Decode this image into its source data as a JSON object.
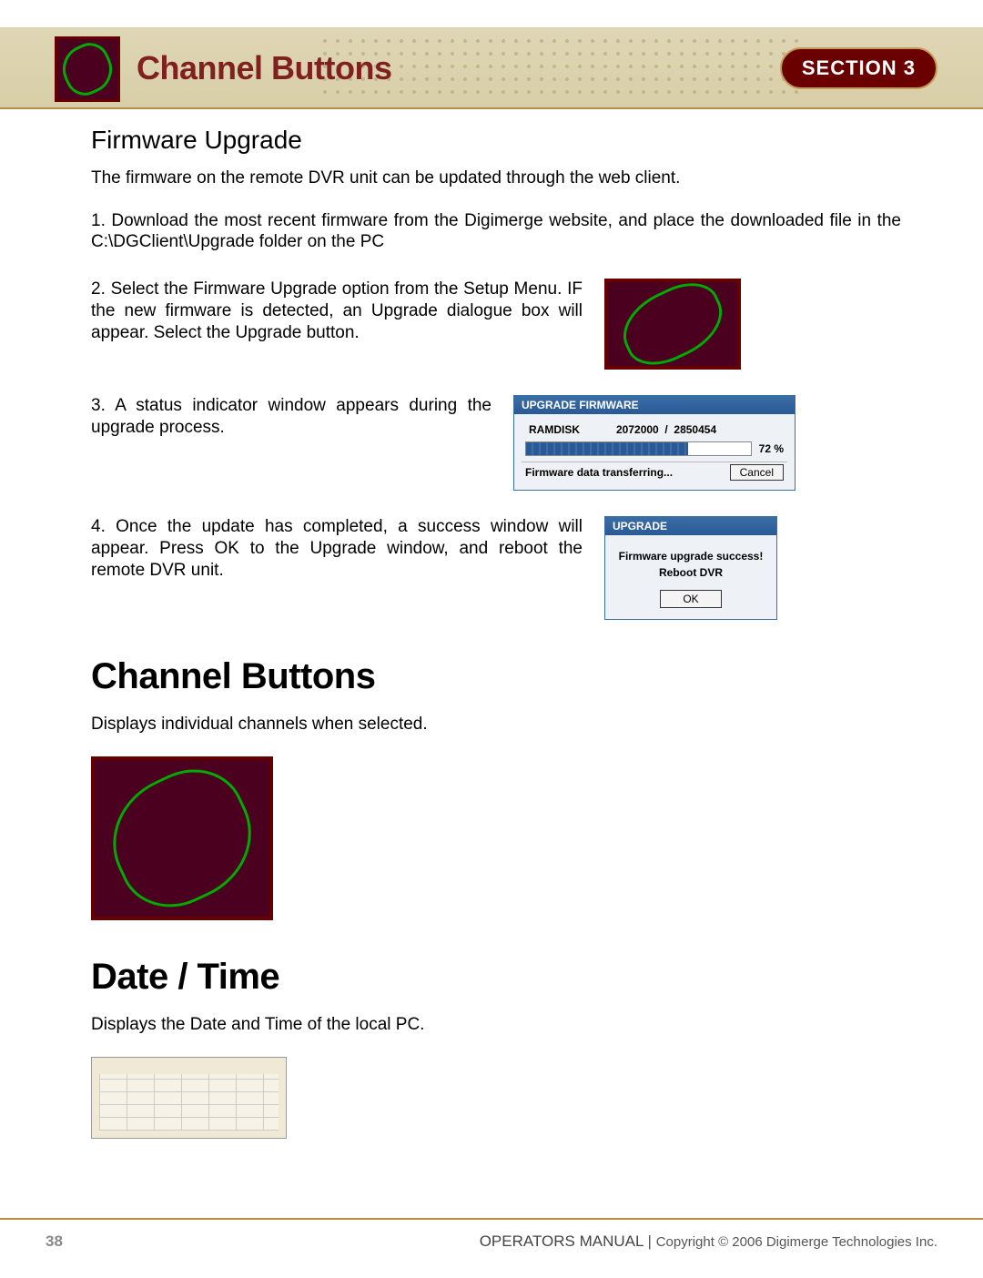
{
  "header": {
    "title": "Channel Buttons",
    "section_label": "SECTION 3"
  },
  "firmware": {
    "heading": "Firmware Upgrade",
    "intro": "The firmware on the remote DVR unit can be updated through the web client.",
    "steps": {
      "s1": "1. Download the most recent firmware from the Digimerge website, and place the downloaded file in the C:\\DGClient\\Upgrade folder on the PC",
      "s2": "2. Select the Firmware Upgrade option from the Setup Menu. IF the new firmware is detected, an Upgrade dialogue box will appear. Select the Upgrade button.",
      "s3": "3. A status indicator window appears during the upgrade process.",
      "s4": "4. Once the update has completed, a success window will appear. Press OK to the Upgrade window, and reboot the remote DVR unit."
    }
  },
  "progress_dlg": {
    "title": "UPGRADE FIRMWARE",
    "label": "RAMDISK",
    "bytes_done": "2072000",
    "bytes_sep": "/",
    "bytes_total": "2850454",
    "pct": "72  %",
    "status": "Firmware data transferring...",
    "cancel": "Cancel"
  },
  "success_dlg": {
    "title": "UPGRADE",
    "line1": "Firmware upgrade success!",
    "line2": "Reboot DVR",
    "ok": "OK"
  },
  "channel_buttons": {
    "heading": "Channel Buttons",
    "text": "Displays individual channels when selected."
  },
  "date_time": {
    "heading": "Date / Time",
    "text": "Displays the Date and Time of the local PC."
  },
  "footer": {
    "page_number": "38",
    "manual": "OPERATORS MANUAL",
    "sep": " | ",
    "copyright_word": "Copyright ",
    "copyright_symbol": "©",
    "copyright_rest": " 2006 Digimerge Technologies Inc."
  }
}
